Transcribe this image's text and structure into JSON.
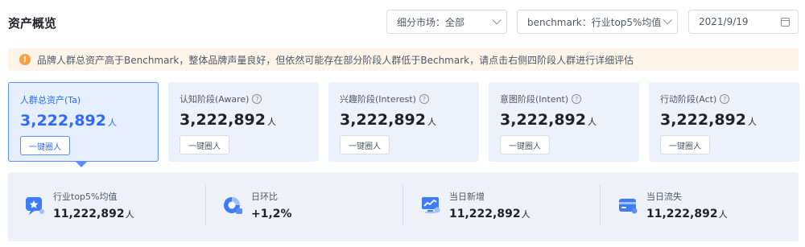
{
  "header": {
    "title": "资产概览",
    "filters": {
      "market": "细分市场：全部",
      "benchmark": "benchmark：行业top5%均值",
      "date": "2021/9/19"
    }
  },
  "notice": {
    "icon": "warning-icon",
    "text": "品牌人群总资产高于Benchmark，整体品牌声量良好，但依然可能存在部分阶段人群低于Bechmark，请点击右侧四阶段人群进行详细评估"
  },
  "cards": [
    {
      "label": "人群总资产(Ta)",
      "value": "3,222,892",
      "unit": "人",
      "button": "一键圈人",
      "active": true
    },
    {
      "label": "认知阶段(Aware)",
      "value": "3,222,892",
      "unit": "人",
      "button": "一键圈人"
    },
    {
      "label": "兴趣阶段(Interest)",
      "value": "3,222,892",
      "unit": "人",
      "button": "一键圈人"
    },
    {
      "label": "意图阶段(Intent)",
      "value": "3,222,892",
      "unit": "人",
      "button": "一键圈人"
    },
    {
      "label": "行动阶段(Act)",
      "value": "3,222,892",
      "unit": "人",
      "button": "一键圈人"
    }
  ],
  "stats": [
    {
      "label": "行业top5%均值",
      "value": "11,222,892",
      "unit": "人",
      "icon": "star-chat-icon"
    },
    {
      "label": "日环比",
      "value": "+1,2%",
      "unit": "",
      "icon": "pie-chart-icon"
    },
    {
      "label": "当日新增",
      "value": "11,222,892",
      "unit": "人",
      "icon": "trend-monitor-icon"
    },
    {
      "label": "当日流失",
      "value": "11,222,892",
      "unit": "人",
      "icon": "wallet-card-icon"
    }
  ],
  "colors": {
    "accent": "#2f6bf6",
    "warning": "#f5a246",
    "card_bg": "#edf1fb"
  }
}
